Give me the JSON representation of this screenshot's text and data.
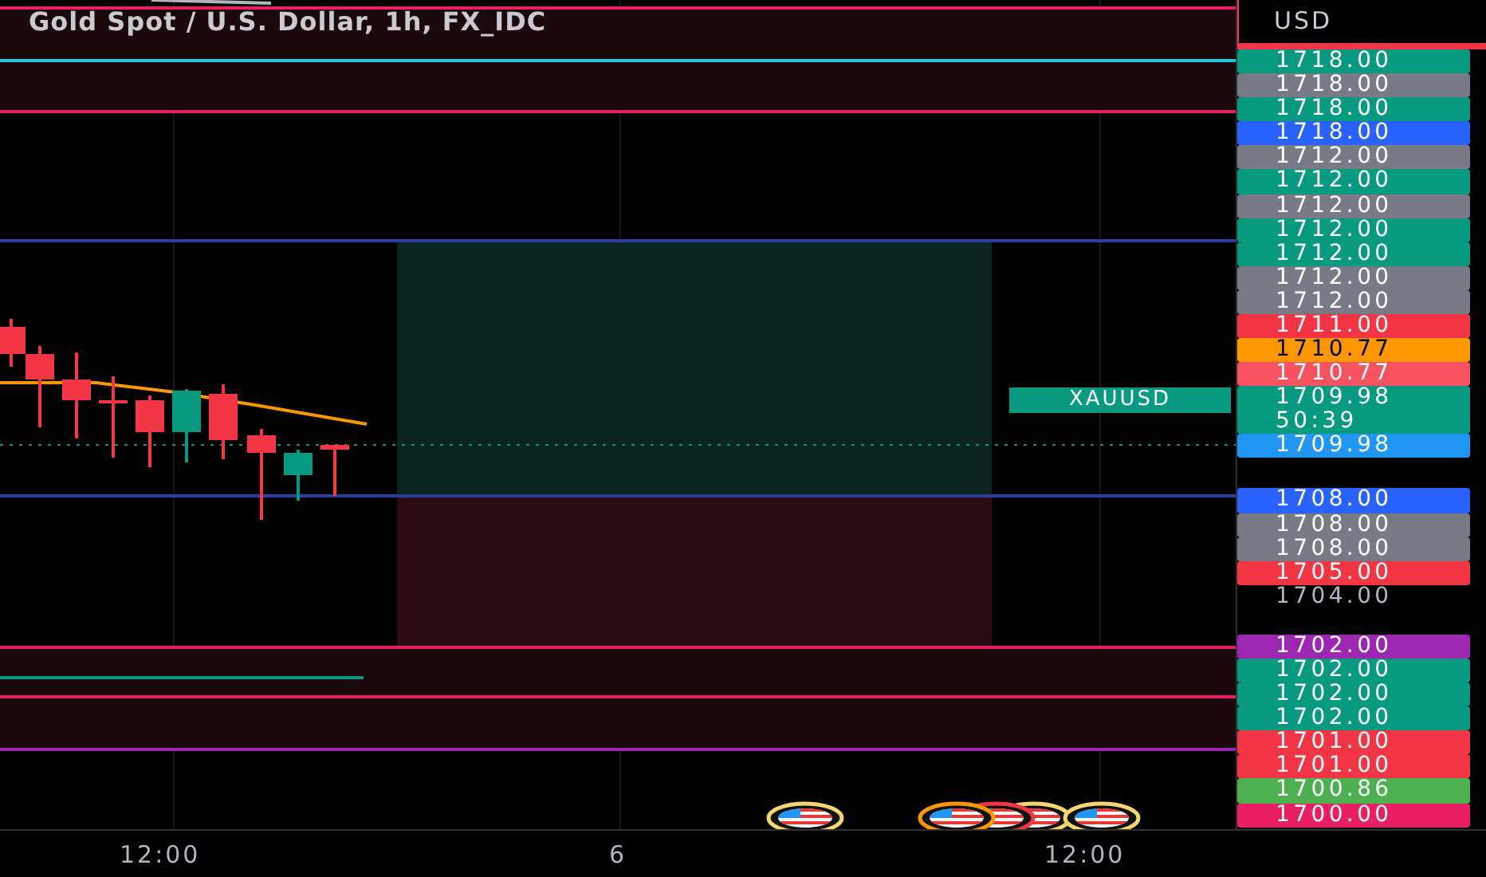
{
  "chart": {
    "title": "Gold Spot / U.S. Dollar, 1h, FX_IDC",
    "symbol_tag": "XAUUSD"
  },
  "price_axis": {
    "currency": "USD",
    "labels": [
      {
        "text": "1718.00",
        "color": "#089981"
      },
      {
        "text": "1718.00",
        "color": "#787b86"
      },
      {
        "text": "1718.00",
        "color": "#089981"
      },
      {
        "text": "1718.00",
        "color": "#2962ff"
      },
      {
        "text": "1712.00",
        "color": "#787b86"
      },
      {
        "text": "1712.00",
        "color": "#089981"
      },
      {
        "text": "1712.00",
        "color": "#787b86"
      },
      {
        "text": "1712.00",
        "color": "#089981"
      },
      {
        "text": "1712.00",
        "color": "#089981"
      },
      {
        "text": "1712.00",
        "color": "#787b86"
      },
      {
        "text": "1712.00",
        "color": "#787b86"
      },
      {
        "text": "1711.00",
        "color": "#f23645"
      },
      {
        "text": "1710.77",
        "color": "#ff9800"
      },
      {
        "text": "1710.77",
        "color": "#f7525f"
      },
      {
        "text": "1709.98",
        "color": "#089981",
        "countdown": "50:39"
      },
      {
        "text": "1709.98",
        "color": "#2196f3"
      },
      {
        "text": "1708.00",
        "color": "#2962ff"
      },
      {
        "text": "1708.00",
        "color": "#787b86"
      },
      {
        "text": "1708.00",
        "color": "#787b86"
      },
      {
        "text": "1705.00",
        "color": "#f23645"
      },
      {
        "text": "1704.00"
      },
      {
        "text": "1702.00",
        "color": "#9c27b0"
      },
      {
        "text": "1702.00",
        "color": "#089981"
      },
      {
        "text": "1702.00",
        "color": "#089981"
      },
      {
        "text": "1702.00",
        "color": "#089981"
      },
      {
        "text": "1701.00",
        "color": "#f23645"
      },
      {
        "text": "1701.00",
        "color": "#f23645"
      },
      {
        "text": "1700.86",
        "color": "#4caf50"
      },
      {
        "text": "1700.00",
        "color": "#e91e63"
      }
    ]
  },
  "time_axis": {
    "labels": [
      "12:00",
      "6",
      "12:00"
    ]
  }
}
